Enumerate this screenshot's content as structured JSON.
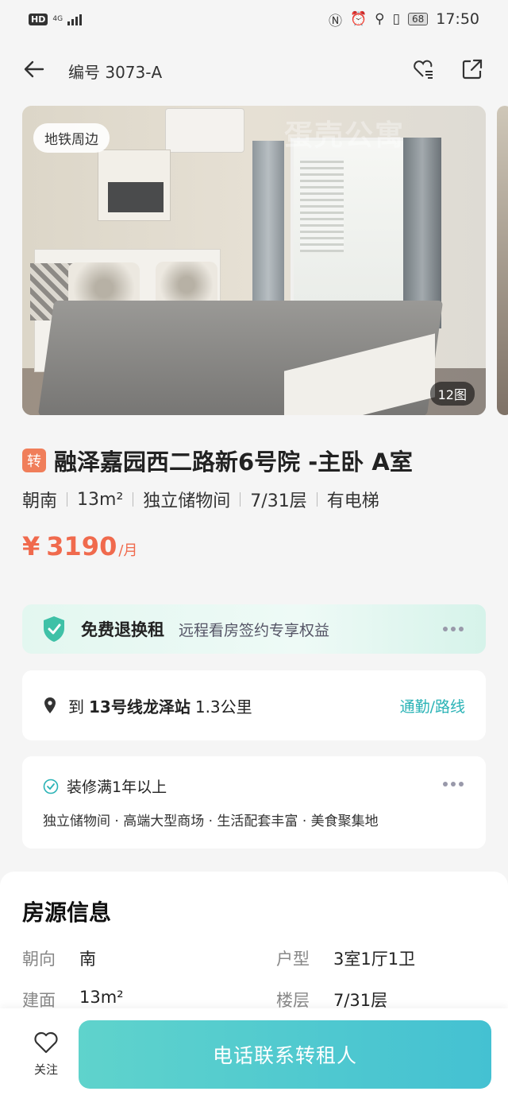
{
  "status_bar": {
    "hd": "HD",
    "network": "4G",
    "battery": "68",
    "time": "17:50"
  },
  "header": {
    "listing_code": "编号 3073-A"
  },
  "gallery": {
    "watermark": "蛋壳公寓",
    "tag": "地铁周边",
    "image_count": "12图"
  },
  "listing": {
    "badge": "转",
    "title": "融泽嘉园西二路新6号院 -主卧 A室",
    "attributes": [
      "朝南",
      "13m²",
      "独立储物间",
      "7/31层",
      "有电梯"
    ],
    "price_symbol": "¥",
    "price": "3190",
    "price_unit": "/月"
  },
  "refund_banner": {
    "title": "免费退换租",
    "subtitle": "远程看房签约专享权益"
  },
  "route": {
    "prefix": "到",
    "station": "13号线龙泽站",
    "distance": "1.3公里",
    "link": "通勤/路线"
  },
  "features": {
    "title": "装修满1年以上",
    "list": "独立储物间 · 高端大型商场 · 生活配套丰富 · 美食聚集地"
  },
  "info": {
    "title": "房源信息",
    "rows": [
      {
        "k": "朝向",
        "v": "南"
      },
      {
        "k": "户型",
        "v": "3室1厅1卫"
      },
      {
        "k": "建面",
        "v": "13m²"
      },
      {
        "k": "楼层",
        "v": "7/31层"
      }
    ]
  },
  "bottom": {
    "follow_label": "关注",
    "call_label": "电话联系转租人"
  },
  "colors": {
    "accent": "#44c1d2",
    "price": "#f06a4d",
    "badge": "#f07e5a",
    "link": "#2ab3b6"
  }
}
